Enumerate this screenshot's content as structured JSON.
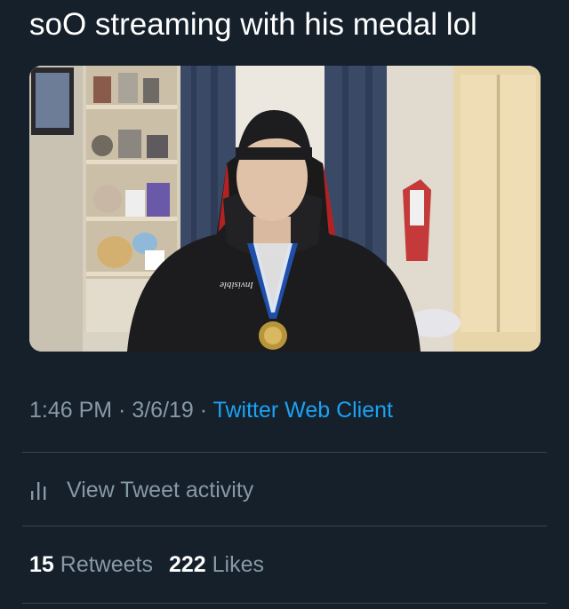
{
  "tweet": {
    "text": "soO streaming with his medal lol"
  },
  "media": {
    "shirt_print": "Invisible"
  },
  "meta": {
    "time": "1:46 PM",
    "sep1": " · ",
    "date": "3/6/19",
    "sep2": " · ",
    "client": "Twitter Web Client"
  },
  "activity": {
    "label": "View Tweet activity",
    "icon": "bar-chart-icon"
  },
  "stats": {
    "retweets_count": "15",
    "retweets_label": "Retweets",
    "likes_count": "222",
    "likes_label": "Likes"
  },
  "colors": {
    "background": "#15202b",
    "secondary_text": "#8899a6",
    "link": "#1da1f2",
    "divider": "#38444d"
  }
}
